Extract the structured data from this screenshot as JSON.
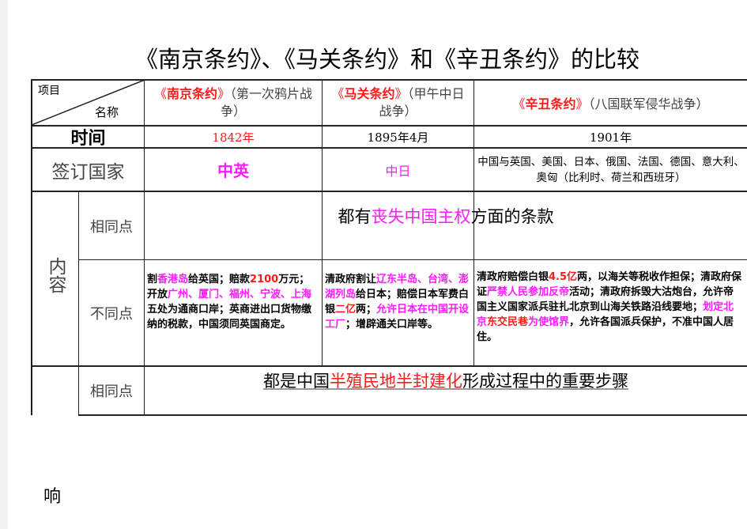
{
  "page": {
    "title": "《南京条约》、《马关条约》和《辛丑条约》的比较",
    "footer_char": "响"
  },
  "header": {
    "corner_top": "项目",
    "corner_bottom": "名称",
    "treaties": [
      {
        "open": "《",
        "name": "南京条约",
        "close": "》",
        "note": "（第一次鸦片战争）"
      },
      {
        "open": "《",
        "name": "马关条约",
        "close": "》",
        "note": "（甲午中日战争）"
      },
      {
        "open": "《",
        "name": "辛丑条约",
        "close": "》",
        "note": "（八国联军侵华战争）"
      }
    ]
  },
  "rows": {
    "time": {
      "label": "时间",
      "values": [
        "1842年",
        "1895年4月",
        "1901年"
      ]
    },
    "countries": {
      "label": "签订国家",
      "values": [
        "中英",
        "中日",
        "中国与英国、美国、日本、俄国、法国、德国、意大利、奥匈（比利时、荷兰和西班牙）"
      ]
    },
    "content": {
      "label": "内容",
      "same_label": "相同点",
      "same": {
        "a": "都有",
        "b": "丧失中国主权",
        "c": "方面的条款"
      },
      "diff_label": "不同点",
      "diff": [
        [
          {
            "t": "割",
            "c": "k"
          },
          {
            "t": "香港岛",
            "c": "m"
          },
          {
            "t": "给英国；赔款",
            "c": "k"
          },
          {
            "t": "2100",
            "c": "r"
          },
          {
            "t": "万元；开放",
            "c": "k"
          },
          {
            "t": "广州、厦门、福州、宁波、上海",
            "c": "m"
          },
          {
            "t": "五处为通商口岸；英商进出口货物缴纳的税款，中国须同英国商定。",
            "c": "k"
          }
        ],
        [
          {
            "t": "清政府割让",
            "c": "k"
          },
          {
            "t": "辽东半岛、台湾、澎湖列岛",
            "c": "m"
          },
          {
            "t": "给日本；赔偿日本军费白银",
            "c": "k"
          },
          {
            "t": "二亿",
            "c": "r"
          },
          {
            "t": "两；",
            "c": "k"
          },
          {
            "t": "允许日本在中国开设工厂",
            "c": "m"
          },
          {
            "t": "；增辟通关口岸等。",
            "c": "k"
          }
        ],
        [
          {
            "t": "清政府赔偿白银",
            "c": "k"
          },
          {
            "t": "4.5亿",
            "c": "r"
          },
          {
            "t": "两，以海关等税收作担保；清政府保证",
            "c": "k"
          },
          {
            "t": "严禁人民参加反帝",
            "c": "m"
          },
          {
            "t": "活动；清政府拆毁大沽炮台，允许帝国主义国家派兵驻扎北京到山海关铁路沿线要地；",
            "c": "k"
          },
          {
            "t": "划定北京",
            "c": "m"
          },
          {
            "t": "东交民巷",
            "c": "r"
          },
          {
            "t": "为使馆界",
            "c": "m"
          },
          {
            "t": "，允许各国派兵保护，不准中国人居住。",
            "c": "k"
          }
        ]
      ]
    },
    "impact": {
      "same_label": "相同点",
      "same": {
        "a": "都是中国",
        "b": "半殖民地半封建化",
        "c": "形成过程中的重要步骤"
      }
    }
  }
}
